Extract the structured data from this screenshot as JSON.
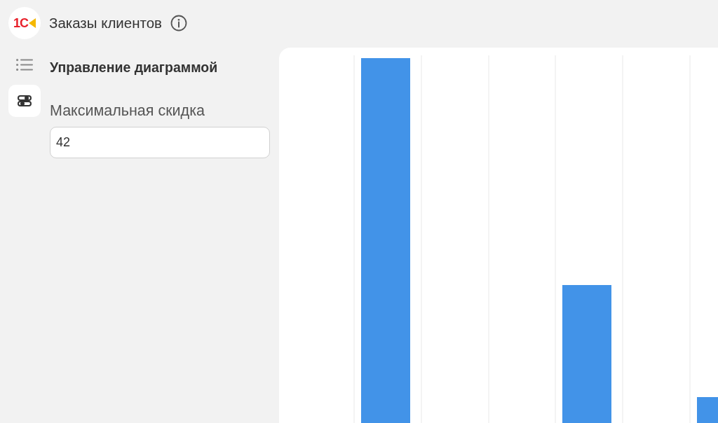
{
  "window": {
    "title": "Заказы клиентов",
    "logo": "1C"
  },
  "sidebar": {
    "items": [
      {
        "kind": "list",
        "selected": false
      },
      {
        "kind": "switches",
        "selected": true
      }
    ]
  },
  "form": {
    "title": "Управление диаграммой",
    "fields": [
      {
        "label": "Максимальная скидка",
        "value": "42"
      }
    ]
  }
}
